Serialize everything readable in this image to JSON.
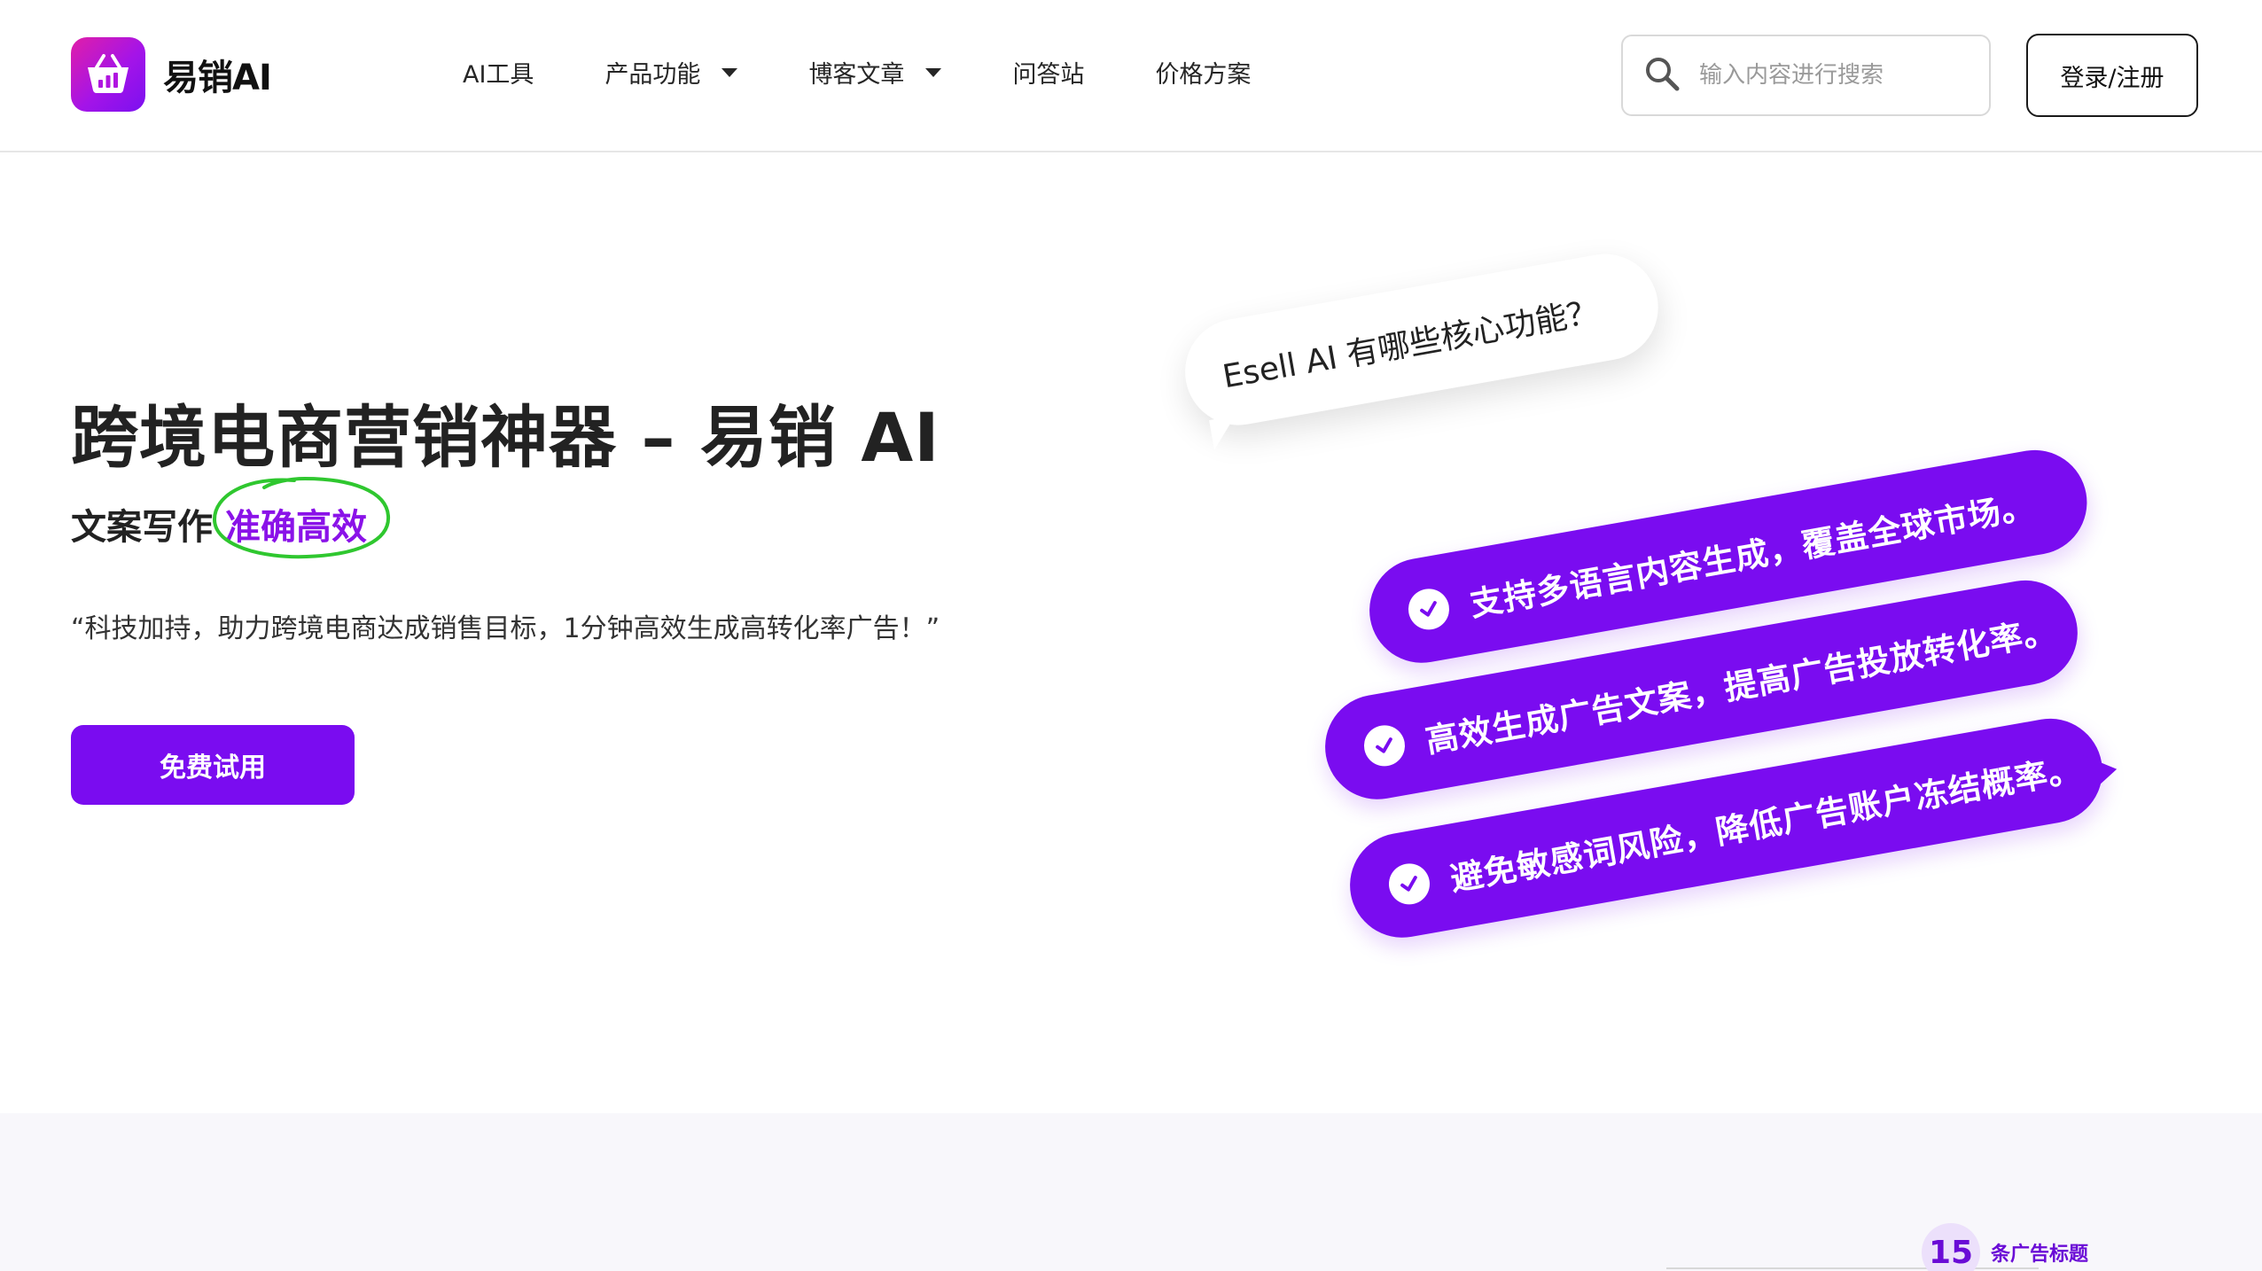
{
  "header": {
    "logo_text": "易销AI",
    "nav": [
      {
        "label": "AI工具"
      },
      {
        "label": "产品功能"
      },
      {
        "label": "博客文章"
      },
      {
        "label": "问答站"
      },
      {
        "label": "价格方案"
      }
    ],
    "search_placeholder": "输入内容进行搜索",
    "login_label": "登录/注册"
  },
  "hero": {
    "title": "跨境电商营销神器 – 易销 AI",
    "subtitle_prefix": "文案写作",
    "subtitle_highlight": "准确高效",
    "quote": "“科技加持，助力跨境电商达成销售目标，1分钟高效生成高转化率广告！”",
    "cta_label": "免费试用"
  },
  "bubbles": {
    "question": "Esell AI 有哪些核心功能？",
    "features": [
      {
        "text": "支持多语言内容生成，覆盖全球市场。"
      },
      {
        "text": "高效生成广告文案，提高广告投放转化率。"
      },
      {
        "text": "避免敏感词风险，降低广告账户冻结概率。"
      }
    ]
  },
  "stat": {
    "number": "15",
    "label": "条广告标题"
  },
  "colors": {
    "brand_purple": "#7a0cf0",
    "highlight_circle": "#2fc72f",
    "lower_section_bg": "#f8f7fb"
  }
}
